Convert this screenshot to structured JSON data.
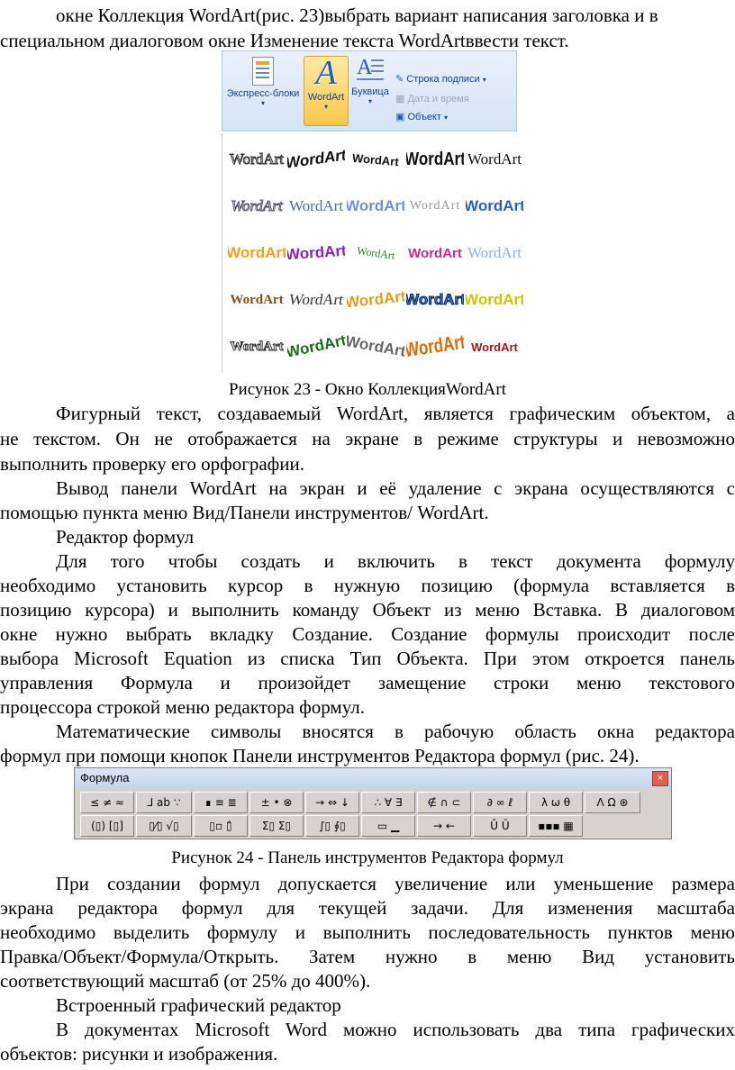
{
  "text_top": [
    "окне Коллекция WordArt(рис. 23)выбрать вариант написания заголовка и в",
    "специальном диалоговом окне Изменение текста WordArtввести текст."
  ],
  "figure23": {
    "caption": "Рисунок 23 - Окно КоллекцияWordArt",
    "ribbon": {
      "express": "Экспресс-блоки",
      "wordart": "WordArt",
      "bukvica": "Буквица",
      "signature": "Строка подписи",
      "datetime": "Дата и время",
      "object": "Объект"
    },
    "sample": "WordArt"
  },
  "paragraphs_a": [
    "Фигурный текст, создаваемый WordArt, является графическим объектом, а",
    "не текстом. Он не отображается на экране в режиме структуры  и  невозможно",
    "выполнить проверку его орфографии.",
    "Вывод панели WordArt на экран  и её удаление с экрана осуществляются с",
    "помощью пункта меню Вид/Панели инструментов/ WordArt.",
    "Редактор формул",
    "Для  того  чтобы  создать  и  включить  в  текст  документа  формулу",
    "необходимо  установить  курсор  в  нужную  позицию  (формула  вставляется  в",
    "позицию курсора) и выполнить команду Объект  из меню Вставка. В диалоговом",
    "окне  нужно  выбрать  вкладку  Создание.  Создание  формулы  происходит  после",
    "выбора  Microsoft  Equation  из  списка  Тип  Объекта.  При  этом  откроется  панель",
    "управления  Формула  и   произойдет  замещение  строки  меню  текстового",
    "процессора строкой меню редактора формул.",
    "Математические  символы  вносятся  в  рабочую  область  окна  редактора",
    "формул при помощи кнопок Панели инструментов Редактора формул  (рис. 24)."
  ],
  "figure24": {
    "title": "Формула",
    "close": "×",
    "row1": [
      "≤ ≠ ≈",
      "⅃ ab ∵",
      "∎ ≡ ≣",
      "± • ⊗",
      "→ ⇔ ↓",
      "∴ ∀ ∃",
      "∉ ∩ ⊂",
      "∂ ∞ ℓ",
      "λ ω θ",
      "Λ Ω ⊛"
    ],
    "row2": [
      "(▯) [▯]",
      "▯⁄▯ √▯",
      "▯▫ ▯̂",
      "Σ▯ Σ▯",
      "∫▯ ∮▯",
      "▭ ▁",
      "→ ←",
      "Ū Ǔ",
      "▪▪▪ ▦"
    ],
    "caption": "Рисунок 24 -  Панель инструментов Редактора формул"
  },
  "paragraphs_b": [
    "При  создании  формул  допускается  увеличение  или  уменьшение  размера",
    "экрана  редактора  формул  для  текущей  задачи.  Для  изменения  масштаба",
    "необходимо выделить формулу и выполнить последовательность пунктов меню",
    "Правка/Объект/Формула/Открыть.  Затем  нужно  в  меню  Вид  установить",
    "соответствующий масштаб (от 25% до 400%).",
    "Встроенный графический редактор",
    "В  документах  Microsoft  Word  можно  использовать  два  типа  графических",
    "объектов: рисунки и изображения."
  ]
}
